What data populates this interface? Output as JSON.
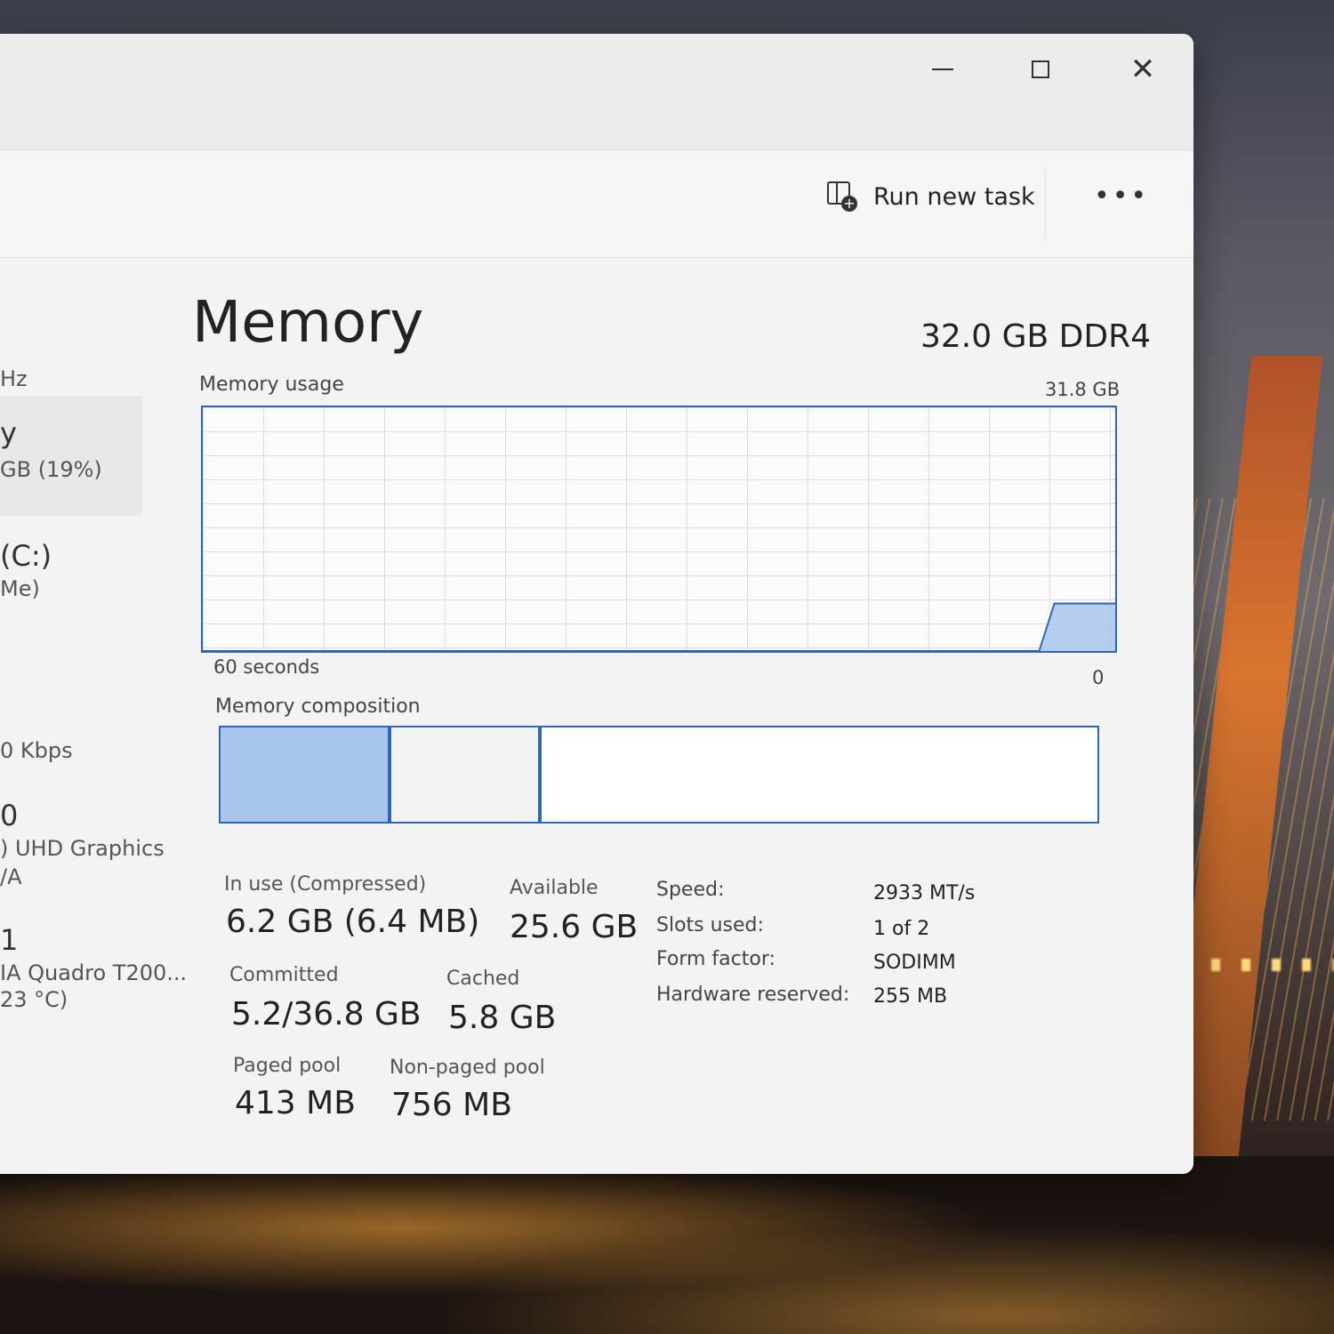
{
  "window": {
    "toolbar": {
      "run_new_task": "Run new task",
      "more": "•••"
    }
  },
  "sidebar": {
    "items": [
      {
        "line1": "Hz"
      },
      {
        "line1": "y",
        "line2": "GB (19%)"
      },
      {
        "line1": "(C:)",
        "line2": "Me)"
      },
      {
        "line1": "0 Kbps"
      },
      {
        "line1": "0",
        "line2": ") UHD Graphics",
        "line3": "/A"
      },
      {
        "line1": "1",
        "line2": "IA Quadro T200...",
        "line3": "23 °C)"
      }
    ]
  },
  "main": {
    "title": "Memory",
    "total": "32.0 GB DDR4",
    "usage_label": "Memory usage",
    "usage_max": "31.8 GB",
    "axis_left": "60 seconds",
    "axis_right": "0",
    "composition_label": "Memory composition"
  },
  "chart_data": {
    "type": "area",
    "x_label_left": "60 seconds",
    "x_label_right": "0",
    "ylim": [
      0,
      31.8
    ],
    "x": [
      60,
      7,
      5,
      4,
      0
    ],
    "y": [
      0,
      0,
      0,
      6.2,
      6.2
    ]
  },
  "composition": {
    "in_use": 6.2,
    "modified": 5.4,
    "standby": 0.0,
    "free": 20.2
  },
  "stats": {
    "in_use_label": "In use (Compressed)",
    "in_use_value": "6.2 GB (6.4 MB)",
    "available_label": "Available",
    "available_value": "25.6 GB",
    "committed_label": "Committed",
    "committed_value": "5.2/36.8 GB",
    "cached_label": "Cached",
    "cached_value": "5.8 GB",
    "paged_label": "Paged pool",
    "paged_value": "413 MB",
    "nonpaged_label": "Non-paged pool",
    "nonpaged_value": "756 MB"
  },
  "specs": {
    "speed_label": "Speed:",
    "speed_value": "2933 MT/s",
    "slots_label": "Slots used:",
    "slots_value": "1 of 2",
    "form_label": "Form factor:",
    "form_value": "SODIMM",
    "reserved_label": "Hardware reserved:",
    "reserved_value": "255 MB"
  },
  "colors": {
    "accent": "#2f66b8",
    "fill": "#a8c6ea"
  }
}
